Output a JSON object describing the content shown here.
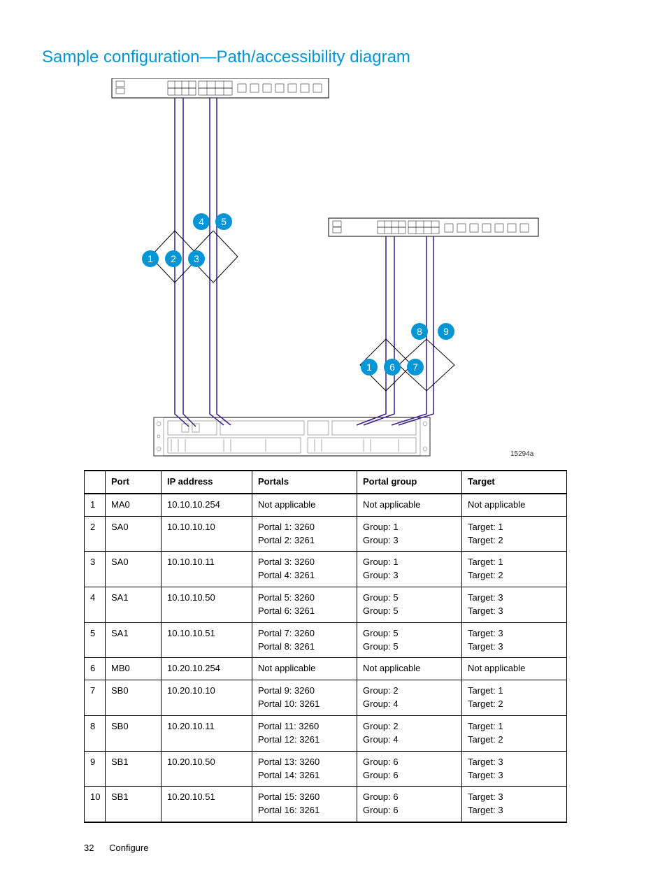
{
  "title": "Sample configuration—Path/accessibility diagram",
  "diagram": {
    "caption": "15294a",
    "callouts_left_row_lower": [
      "1",
      "2",
      "3"
    ],
    "callouts_left_row_upper": [
      "4",
      "5"
    ],
    "callouts_right_row_lower": [
      "1",
      "6",
      "7"
    ],
    "callouts_right_row_upper": [
      "8",
      "9"
    ]
  },
  "table": {
    "headers": {
      "num": "",
      "port": "Port",
      "ip": "IP address",
      "portals": "Portals",
      "group": "Portal group",
      "target": "Target"
    },
    "rows": [
      {
        "num": "1",
        "port": "MA0",
        "ip": "10.10.10.254",
        "portals": [
          "Not applicable"
        ],
        "group": [
          "Not applicable"
        ],
        "target": [
          "Not applicable"
        ]
      },
      {
        "num": "2",
        "port": "SA0",
        "ip": "10.10.10.10",
        "portals": [
          "Portal 1: 3260",
          "Portal 2: 3261"
        ],
        "group": [
          "Group: 1",
          "Group: 3"
        ],
        "target": [
          "Target: 1",
          "Target: 2"
        ]
      },
      {
        "num": "3",
        "port": "SA0",
        "ip": "10.10.10.11",
        "portals": [
          "Portal 3: 3260",
          "Portal 4: 3261"
        ],
        "group": [
          "Group: 1",
          "Group: 3"
        ],
        "target": [
          "Target: 1",
          "Target: 2"
        ]
      },
      {
        "num": "4",
        "port": "SA1",
        "ip": "10.10.10.50",
        "portals": [
          "Portal 5: 3260",
          "Portal 6: 3261"
        ],
        "group": [
          "Group: 5",
          "Group: 5"
        ],
        "target": [
          "Target: 3",
          "Target: 3"
        ]
      },
      {
        "num": "5",
        "port": "SA1",
        "ip": "10.10.10.51",
        "portals": [
          "Portal 7: 3260",
          "Portal 8: 3261"
        ],
        "group": [
          "Group: 5",
          "Group: 5"
        ],
        "target": [
          "Target: 3",
          "Target: 3"
        ]
      },
      {
        "num": "6",
        "port": "MB0",
        "ip": "10.20.10.254",
        "portals": [
          "Not applicable"
        ],
        "group": [
          "Not applicable"
        ],
        "target": [
          "Not applicable"
        ]
      },
      {
        "num": "7",
        "port": "SB0",
        "ip": "10.20.10.10",
        "portals": [
          "Portal 9: 3260",
          "Portal 10: 3261"
        ],
        "group": [
          "Group: 2",
          "Group: 4"
        ],
        "target": [
          "Target: 1",
          "Target: 2"
        ]
      },
      {
        "num": "8",
        "port": "SB0",
        "ip": "10.20.10.11",
        "portals": [
          "Portal 11: 3260",
          "Portal 12: 3261"
        ],
        "group": [
          "Group: 2",
          "Group: 4"
        ],
        "target": [
          "Target: 1",
          "Target: 2"
        ]
      },
      {
        "num": "9",
        "port": "SB1",
        "ip": "10.20.10.50",
        "portals": [
          "Portal 13: 3260",
          "Portal 14: 3261"
        ],
        "group": [
          "Group: 6",
          "Group: 6"
        ],
        "target": [
          "Target: 3",
          "Target: 3"
        ]
      },
      {
        "num": "10",
        "port": "SB1",
        "ip": "10.20.10.51",
        "portals": [
          "Portal 15: 3260",
          "Portal 16: 3261"
        ],
        "group": [
          "Group: 6",
          "Group: 6"
        ],
        "target": [
          "Target: 3",
          "Target: 3"
        ]
      }
    ]
  },
  "footer": {
    "page": "32",
    "section": "Configure"
  }
}
